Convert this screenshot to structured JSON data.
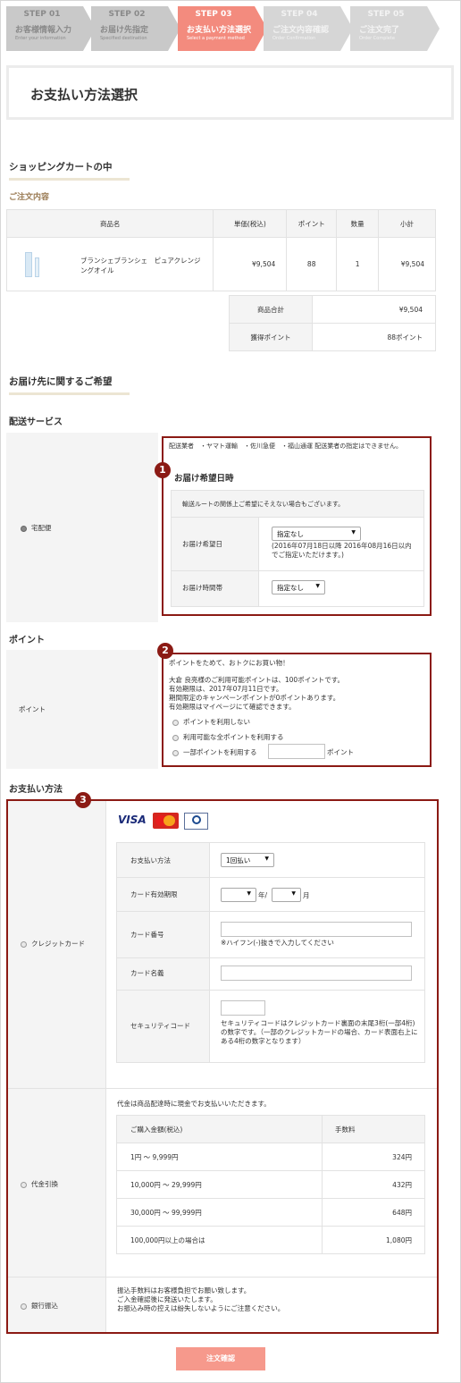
{
  "steps": [
    {
      "num": "STEP 01",
      "title": "お客様情報入力",
      "en": "Enter your information"
    },
    {
      "num": "STEP 02",
      "title": "お届け先指定",
      "en": "Specified destination"
    },
    {
      "num": "STEP 03",
      "title": "お支払い方法選択",
      "en": "Select a payment method"
    },
    {
      "num": "STEP 04",
      "title": "ご注文内容確認",
      "en": "Order Confirmation"
    },
    {
      "num": "STEP 05",
      "title": "ご注文完了",
      "en": "Order Complete"
    }
  ],
  "page_title": "お支払い方法選択",
  "cart": {
    "heading": "ショッピングカートの中",
    "subheading": "ご注文内容",
    "columns": [
      "商品名",
      "単価(税込)",
      "ポイント",
      "数量",
      "小計"
    ],
    "item": {
      "name": "ブランシェブランシェ　ピュアクレンジングオイル",
      "price": "¥9,504",
      "points": "88",
      "qty": "1",
      "subtotal": "¥9,504"
    },
    "total_label": "商品合計",
    "total_value": "¥9,504",
    "earned_label": "獲得ポイント",
    "earned_value": "88ポイント"
  },
  "delivery": {
    "heading": "お届け先に関するご希望",
    "service_heading": "配送サービス",
    "service_option": "宅配便",
    "carrier_note": "配送業者　・ヤマト運輸　・佐川急便　・福山通運 配送業者の指定はできません。",
    "date_heading": "お届け希望日時",
    "route_note": "輸送ルートの関係上ご希望にそえない場合もございます。",
    "date_label": "お届け希望日",
    "date_select": "指定なし",
    "date_note": "(2016年07月18日以降 2016年08月16日以内 でご指定いただけます。)",
    "time_label": "お届け時間帯",
    "time_select": "指定なし"
  },
  "points": {
    "heading": "ポイント",
    "row_label": "ポイント",
    "intro": "ポイントをためて、おトクにお買い物！",
    "line1": "大倉 良亮様のご利用可能ポイントは、100ポイントです。",
    "line2": "有効期限は、2017年07月11日です。",
    "line3": "期間限定のキャンペーンポイントが0ポイントあります。",
    "line4": "有効期限はマイページにて確認できます。",
    "opt_none": "ポイントを利用しない",
    "opt_all": "利用可能な全ポイントを利用する",
    "opt_part": "一部ポイントを利用する",
    "unit": "ポイント"
  },
  "payment": {
    "heading": "お支払い方法",
    "credit_label": "クレジットカード",
    "cards": [
      "VISA",
      "MasterCard",
      "Diners Club"
    ],
    "method_label": "お支払い方法",
    "method_select": "1回払い",
    "expiry_label": "カード有効期限",
    "year_unit": "年/",
    "month_unit": "月",
    "number_label": "カード番号",
    "number_note": "※ハイフン(-)抜きで入力してください",
    "holder_label": "カード名義",
    "cvc_label": "セキュリティコード",
    "cvc_note": "セキュリティコードはクレジットカード裏面の末尾3桁(一部4桁)の数字です。（一部のクレジットカードの場合、カード表面右上にある4桁の数字となります）",
    "cod_label": "代金引換",
    "cod_note": "代金は商品配達時に現金でお支払いいただきます。",
    "cod_columns": [
      "ご購入金額(税込)",
      "手数料"
    ],
    "cod_rows": [
      {
        "range": "1円 ～ 9,999円",
        "fee": "324円"
      },
      {
        "range": "10,000円 ～ 29,999円",
        "fee": "432円"
      },
      {
        "range": "30,000円 ～ 99,999円",
        "fee": "648円"
      },
      {
        "range": "100,000円以上の場合は",
        "fee": "1,080円"
      }
    ],
    "bank_label": "銀行振込",
    "bank_note1": "振込手数料はお客様負担でお願い致します。",
    "bank_note2": "ご入金確認後に発送いたします。",
    "bank_note3": "お振込み時の控えは紛失しないようにご注意ください。"
  },
  "badges": [
    "1",
    "2",
    "3"
  ],
  "confirm_button": "注文確認",
  "colors": {
    "accent": "#f38b7e",
    "highlight_border": "#8b1a14",
    "label_gold": "#9b7c55"
  }
}
